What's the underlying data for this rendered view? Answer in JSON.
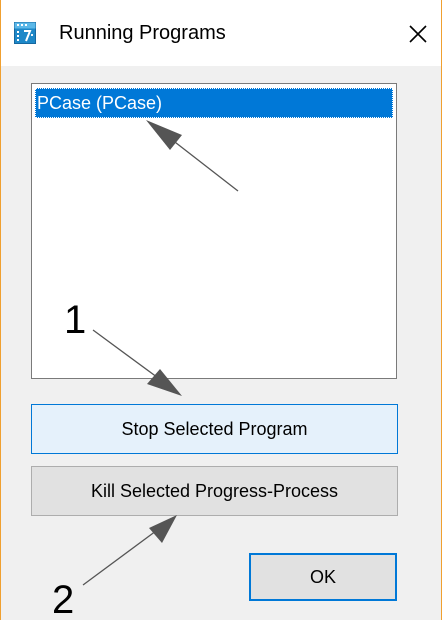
{
  "window": {
    "title": "Running Programs",
    "close_icon": "close-icon",
    "app_icon": "calendar-app-icon",
    "accent_color": "#0078d7",
    "border_color": "#f0a030"
  },
  "programs": {
    "items": [
      {
        "label": "PCase (PCase)",
        "selected": true
      }
    ]
  },
  "buttons": {
    "stop_label": "Stop Selected Program",
    "kill_label": "Kill Selected Progress-Process",
    "ok_label": "OK"
  },
  "annotations": {
    "callout_1": "1",
    "callout_2": "2"
  }
}
